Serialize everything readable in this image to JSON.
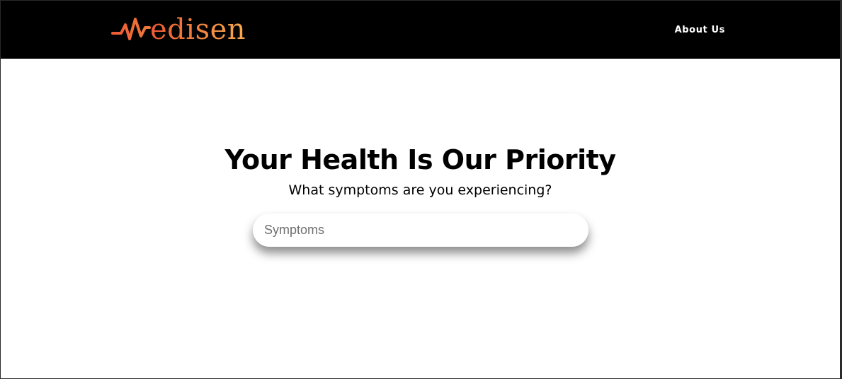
{
  "brand": {
    "name": "edisen",
    "icon": "heartbeat-m-icon",
    "gradient": [
      "#ee5a35",
      "#f07d3c",
      "#f6a94c"
    ]
  },
  "nav": {
    "about_label": "About Us"
  },
  "hero": {
    "title": "Your Health Is Our Priority",
    "subtitle": "What symptoms are you experiencing?"
  },
  "search": {
    "placeholder": "Symptoms",
    "value": ""
  },
  "colors": {
    "navbar_bg": "#000000",
    "page_bg": "#ffffff",
    "text": "#000000"
  }
}
